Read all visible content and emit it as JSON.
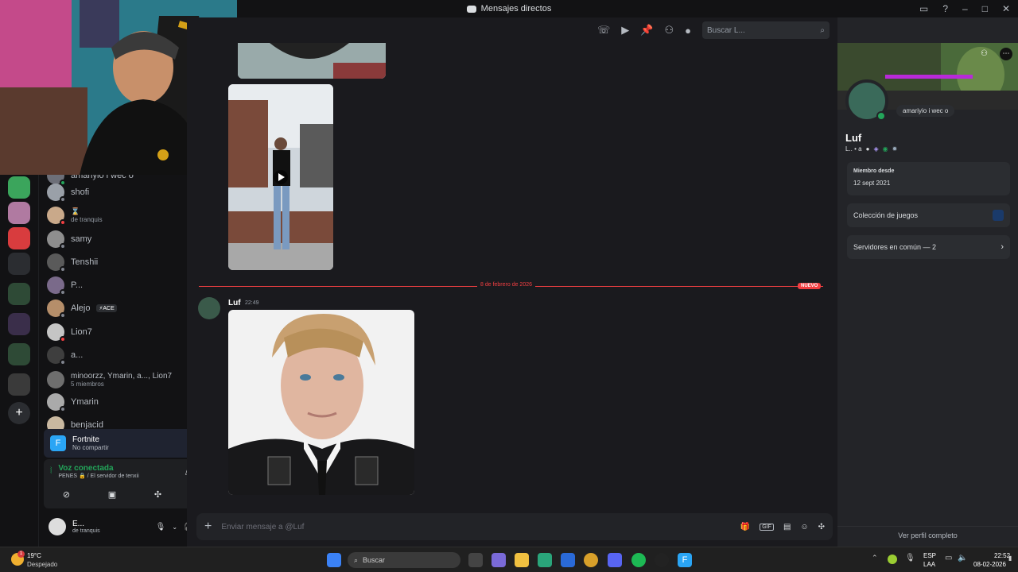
{
  "window": {
    "title": "Mensajes directos"
  },
  "dm_list": [
    {
      "name": "amariyio i wec o",
      "sub": ""
    },
    {
      "name": "shofi",
      "sub": ""
    },
    {
      "name": "",
      "sub": "de tranquis"
    },
    {
      "name": "samy",
      "sub": ""
    },
    {
      "name": "Tenshii",
      "sub": ""
    },
    {
      "name": "P...",
      "sub": ""
    },
    {
      "name": "Alejo",
      "sub": "",
      "badge": "ACE"
    },
    {
      "name": "Lion7",
      "sub": ""
    },
    {
      "name": "a...",
      "sub": ""
    },
    {
      "name": "minoorzz, Ymarin, a..., Lion7",
      "sub": "5 miembros"
    },
    {
      "name": "Ymarin",
      "sub": ""
    },
    {
      "name": "benjacid",
      "sub": ""
    }
  ],
  "activity": {
    "title": "Fortnite",
    "sub": "No compartir"
  },
  "voice": {
    "title": "Voz conectada",
    "sub": "PENES 🔒 / El servidor de tenxii"
  },
  "user": {
    "name": "E...",
    "status": "de tranquis"
  },
  "chat": {
    "divider_date": "8 de febrero de 2026",
    "new_badge": "NUEVO",
    "author": "Luf",
    "time": "22:49",
    "input_placeholder": "Enviar mensaje a @Luf",
    "search_placeholder": "Buscar L..."
  },
  "profile": {
    "status_text": "amariyio i wec o",
    "name": "Luf",
    "tag": "L.. • a",
    "member_since_label": "Miembro desde",
    "member_since": "12 sept 2021",
    "games_label": "Colección de juegos",
    "servers_label": "Servidores en común — 2",
    "full_profile": "Ver perfil completo"
  },
  "taskbar": {
    "temp": "19°C",
    "weather": "Despejado",
    "search": "Buscar",
    "lang": "ESP",
    "lang_sub": "LAA",
    "time": "22:52",
    "date": "08-02-2026",
    "weather_badge": "1"
  },
  "colors": {
    "accent_red": "#f23f42",
    "online": "#23a55a",
    "blurple": "#5865f2"
  }
}
